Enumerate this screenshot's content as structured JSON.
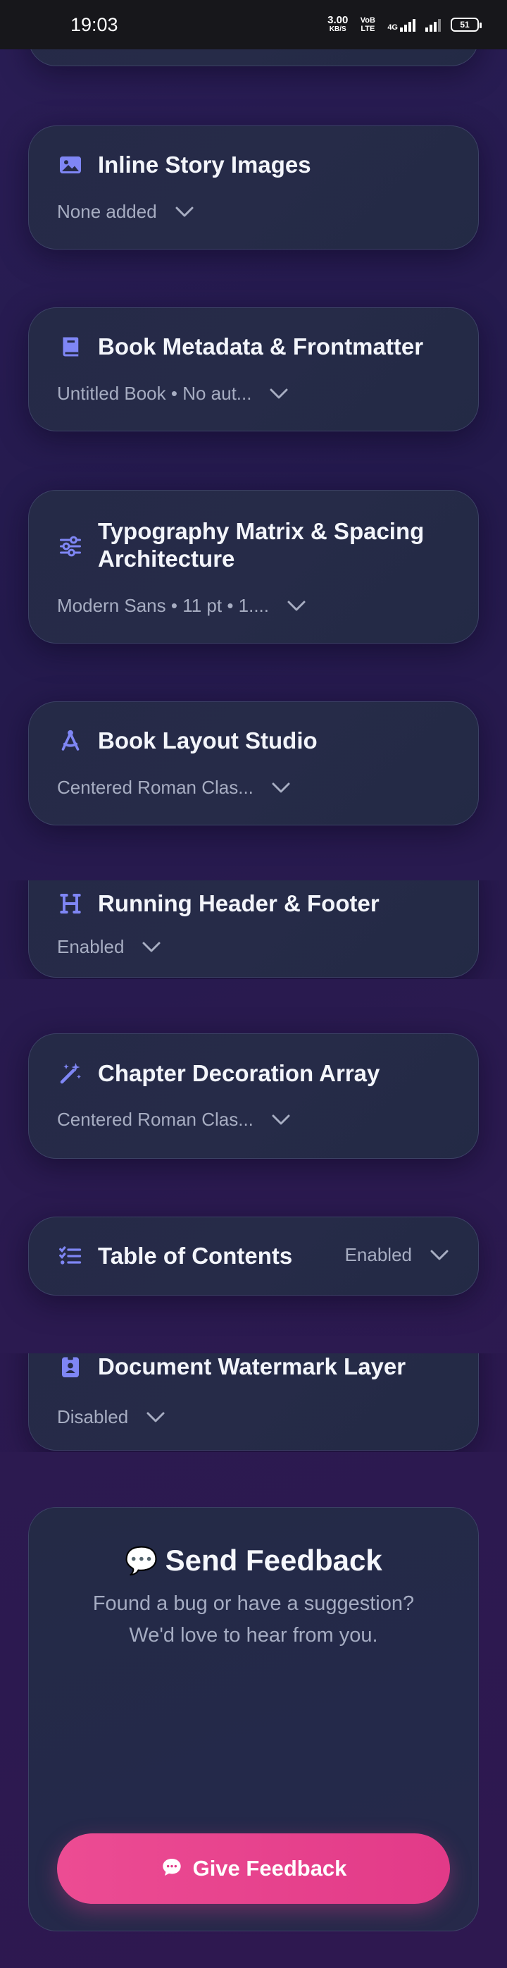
{
  "status_bar": {
    "time": "19:03",
    "net_speed_value": "3.00",
    "net_speed_unit": "KB/S",
    "volte": "VoB LTE",
    "network_type": "4G",
    "battery": "51"
  },
  "cards": {
    "inline_story_images": {
      "title": "Inline Story Images",
      "subtitle": "None added"
    },
    "book_metadata": {
      "title": "Book Metadata & Frontmatter",
      "subtitle": "Untitled Book • No aut..."
    },
    "typography_matrix": {
      "title_line1": "Typography Matrix & Spacing",
      "title_line2": "Architecture",
      "subtitle": "Modern Sans • 11 pt • 1...."
    },
    "book_layout_studio": {
      "title": "Book Layout Studio",
      "subtitle": "Centered Roman Clas..."
    },
    "running_header": {
      "title": "Running Header & Footer",
      "subtitle": "Enabled"
    },
    "chapter_decoration": {
      "title": "Chapter Decoration Array",
      "subtitle": "Centered Roman Clas..."
    },
    "table_of_contents": {
      "title": "Table of Contents",
      "status": "Enabled"
    },
    "document_watermark": {
      "title": "Document Watermark Layer",
      "subtitle": "Disabled"
    }
  },
  "feedback": {
    "emoji": "💬",
    "title": "Send Feedback",
    "text_line1": "Found a bug or have a suggestion?",
    "text_line2": "We'd love to hear from you.",
    "button_label": "Give Feedback"
  },
  "colors": {
    "accent_icon": "#7f86f5",
    "feedback_button": "#e8408e",
    "card_background": "#252a47",
    "page_background": "#261b4f"
  }
}
